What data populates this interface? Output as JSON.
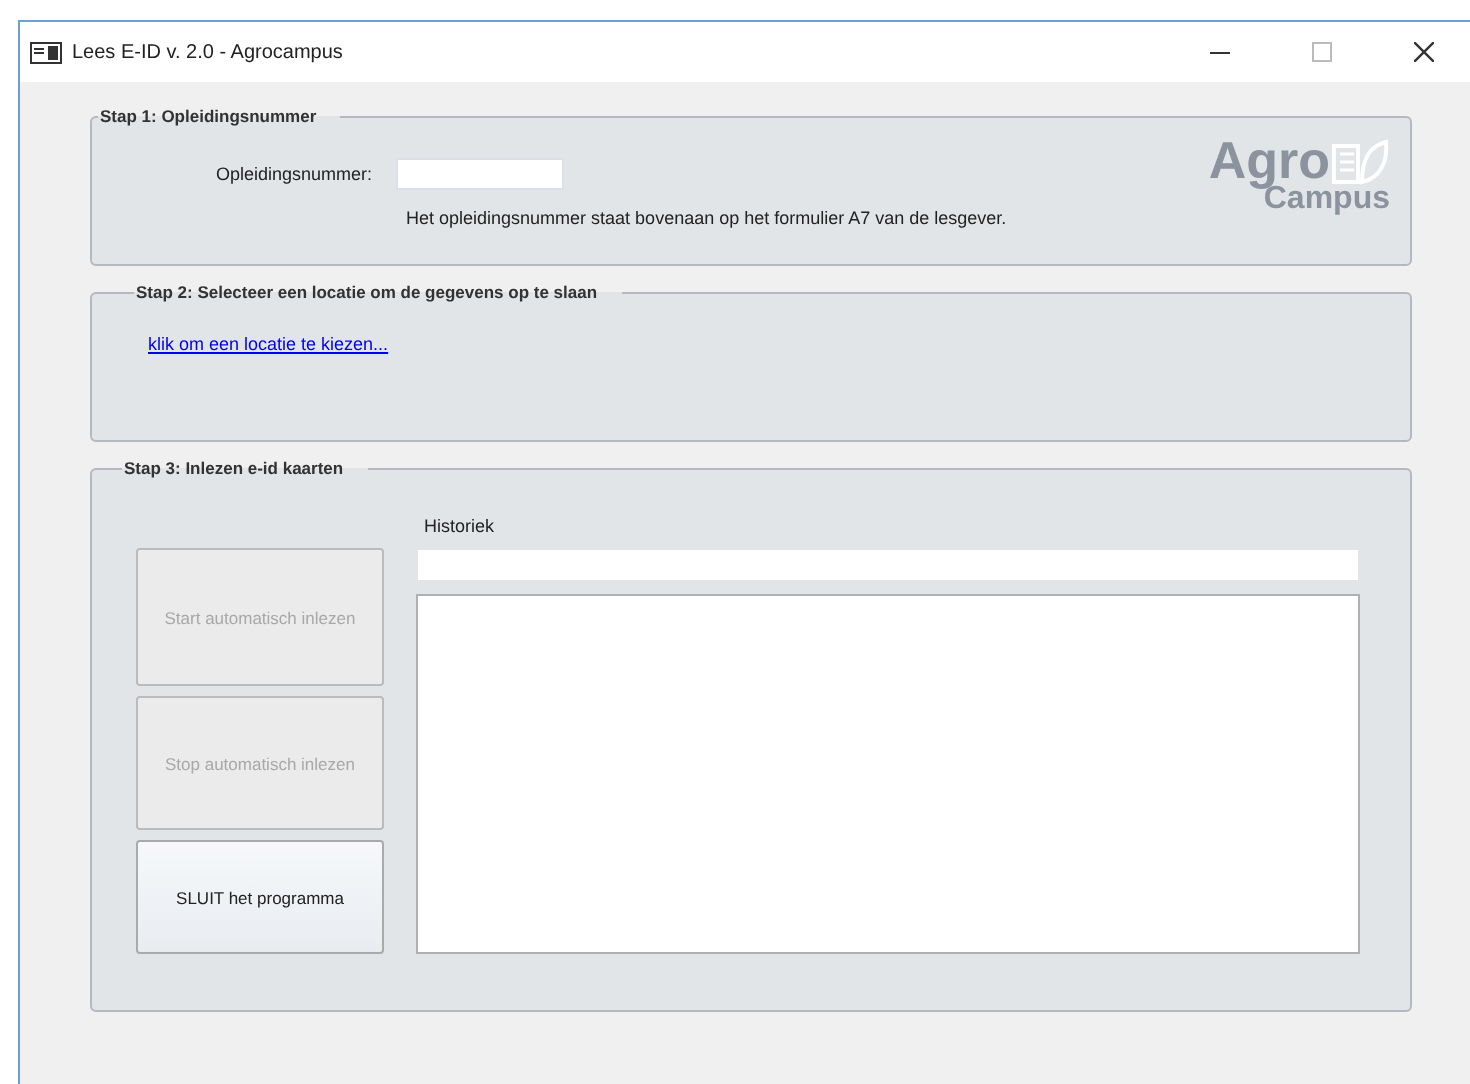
{
  "window": {
    "title": "Lees E-ID v. 2.0 - Agrocampus"
  },
  "step1": {
    "legend": "Stap 1: Opleidingsnummer",
    "label": "Opleidingsnummer:",
    "hint": "Het opleidingsnummer staat bovenaan op het formulier A7 van de lesgever.",
    "logo": {
      "top": "Agro",
      "bottom": "Campus"
    }
  },
  "step2": {
    "legend": "Stap 2: Selecteer een locatie om de gegevens op te slaan",
    "link": "klik om een locatie te kiezen..."
  },
  "step3": {
    "legend": "Stap 3: Inlezen e-id kaarten",
    "history_label": "Historiek",
    "buttons": [
      {
        "label": "Start automatisch inlezen",
        "disabled": true
      },
      {
        "label": "Stop automatisch inlezen",
        "disabled": true
      },
      {
        "label": "SLUIT het programma",
        "disabled": false
      }
    ]
  }
}
